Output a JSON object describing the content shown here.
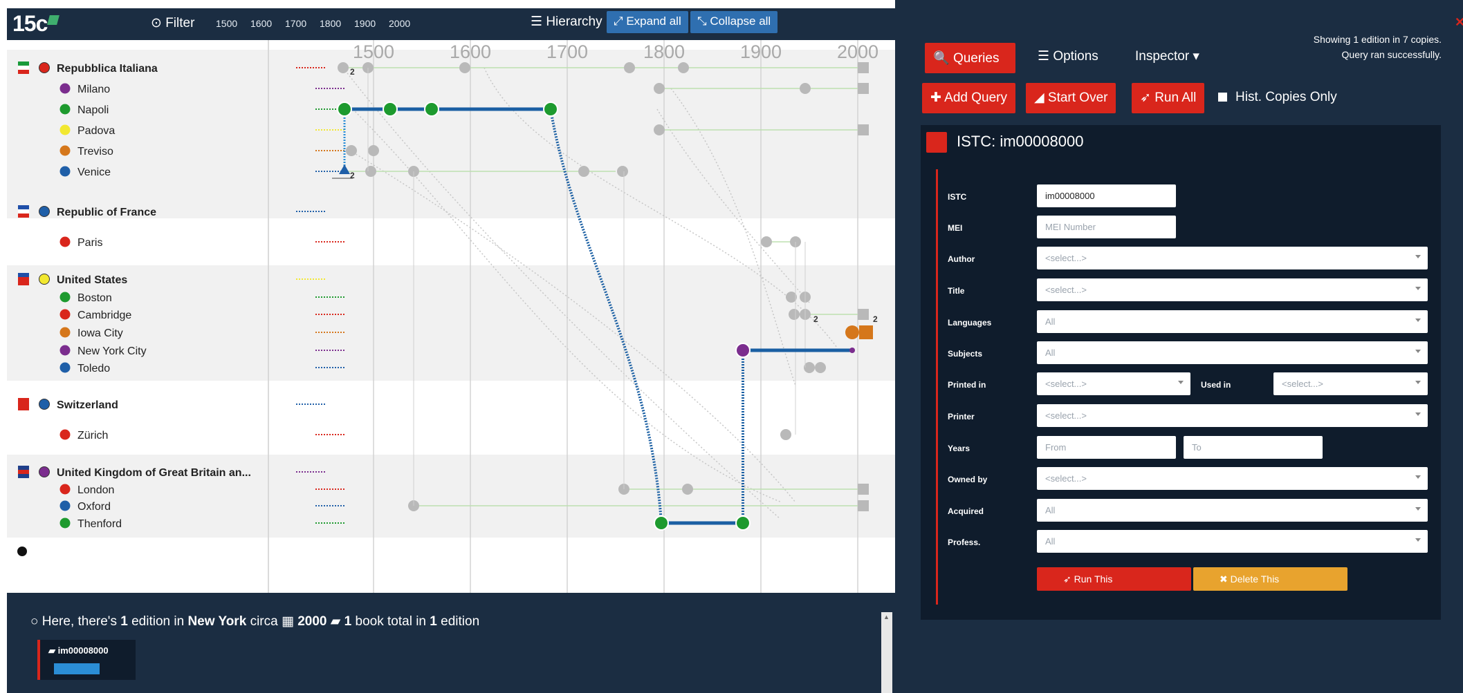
{
  "topbar": {
    "logo": "15c",
    "filter_label": "Filter",
    "year_links": [
      "1500",
      "1600",
      "1700",
      "1800",
      "1900",
      "2000"
    ],
    "hierarchy_label": "Hierarchy",
    "expand_all": "Expand all",
    "collapse_all": "Collapse all"
  },
  "colors": {
    "navy": "#1b2d42",
    "red": "#d9261c",
    "orange": "#e8a32e",
    "blue_button": "#2f6fb0",
    "line_blue": "#1a5fa3",
    "green": "#1d9a2e",
    "purple": "#7b2d8e",
    "yellow": "#f2e830",
    "amber": "#d5771b",
    "venice_blue": "#1f5fa8"
  },
  "chart": {
    "axis_years": [
      "1500",
      "1600",
      "1700",
      "1800",
      "1900",
      "2000"
    ],
    "groups": [
      {
        "name": "Repubblica Italiana",
        "flag": "it",
        "dot": "red",
        "cities": [
          {
            "name": "Milano",
            "dot": "purple"
          },
          {
            "name": "Napoli",
            "dot": "green"
          },
          {
            "name": "Padova",
            "dot": "yellow"
          },
          {
            "name": "Treviso",
            "dot": "amber"
          },
          {
            "name": "Venice",
            "dot": "venice_blue"
          }
        ]
      },
      {
        "name": "Republic of France",
        "flag": "fr",
        "dot": "venice_blue",
        "cities": [
          {
            "name": "Paris",
            "dot": "red"
          }
        ]
      },
      {
        "name": "United States",
        "flag": "us",
        "dot": "yellow",
        "cities": [
          {
            "name": "Boston",
            "dot": "green"
          },
          {
            "name": "Cambridge",
            "dot": "red"
          },
          {
            "name": "Iowa City",
            "dot": "amber"
          },
          {
            "name": "New York City",
            "dot": "purple"
          },
          {
            "name": "Toledo",
            "dot": "venice_blue"
          }
        ]
      },
      {
        "name": "Switzerland",
        "flag": "ch",
        "dot": "venice_blue",
        "cities": [
          {
            "name": "Zürich",
            "dot": "red"
          }
        ]
      },
      {
        "name": "United Kingdom of Great Britain an...",
        "flag": "uk",
        "dot": "purple",
        "cities": [
          {
            "name": "London",
            "dot": "red"
          },
          {
            "name": "Oxford",
            "dot": "venice_blue"
          },
          {
            "name": "Thenford",
            "dot": "green"
          }
        ]
      }
    ],
    "count_labels": [
      "2",
      "2",
      "2",
      "2"
    ]
  },
  "info": {
    "prefix": "Here, there's",
    "count": "1",
    "middle": "edition in",
    "place": "New York",
    "circa": "circa",
    "year": "2000",
    "books": "1",
    "suffix": "book total in",
    "editions": "1",
    "end": "edition",
    "box_label": "im00008000"
  },
  "right": {
    "showing_line1": "Showing 1 edition in 7 copies.",
    "showing_line2": "Query ran successfully.",
    "tab_queries": "Queries",
    "tab_options": "Options",
    "tab_inspector": "Inspector",
    "add_query": "Add Query",
    "start_over": "Start Over",
    "run_all": "Run All",
    "hist_copies": "Hist. Copies Only"
  },
  "query": {
    "title": "ISTC: im00008000",
    "fields": {
      "istc_label": "ISTC",
      "istc_value": "im00008000",
      "mei_label": "MEI",
      "mei_placeholder": "MEI Number",
      "author_label": "Author",
      "author_value": "<select...>",
      "title_label": "Title",
      "title_value": "<select...>",
      "languages_label": "Languages",
      "languages_value": "All",
      "subjects_label": "Subjects",
      "subjects_value": "All",
      "printed_in_label": "Printed in",
      "printed_in_value": "<select...>",
      "used_in_label": "Used in",
      "used_in_value": "<select...>",
      "printer_label": "Printer",
      "printer_value": "<select...>",
      "years_label": "Years",
      "years_from": "From",
      "years_to": "To",
      "owned_by_label": "Owned by",
      "owned_by_value": "<select...>",
      "acquired_label": "Acquired",
      "acquired_value": "All",
      "profess_label": "Profess.",
      "profess_value": "All"
    },
    "run_this": "Run This",
    "delete_this": "Delete This"
  }
}
